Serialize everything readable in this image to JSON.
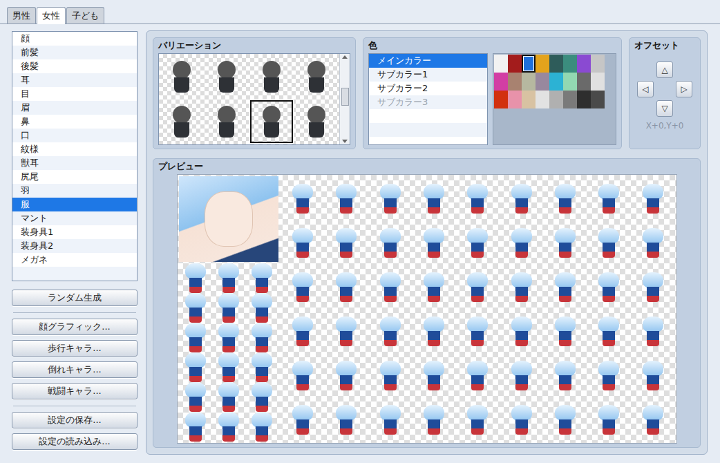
{
  "tabs": [
    {
      "label": "男性",
      "selected": false
    },
    {
      "label": "女性",
      "selected": true
    },
    {
      "label": "子ども",
      "selected": false
    }
  ],
  "parts": {
    "items": [
      {
        "label": "顔",
        "selected": false
      },
      {
        "label": "前髪",
        "selected": false
      },
      {
        "label": "後髪",
        "selected": false
      },
      {
        "label": "耳",
        "selected": false
      },
      {
        "label": "目",
        "selected": false
      },
      {
        "label": "眉",
        "selected": false
      },
      {
        "label": "鼻",
        "selected": false
      },
      {
        "label": "口",
        "selected": false
      },
      {
        "label": "紋様",
        "selected": false
      },
      {
        "label": "獣耳",
        "selected": false
      },
      {
        "label": "尻尾",
        "selected": false
      },
      {
        "label": "羽",
        "selected": false
      },
      {
        "label": "服",
        "selected": true
      },
      {
        "label": "マント",
        "selected": false
      },
      {
        "label": "装身具1",
        "selected": false
      },
      {
        "label": "装身具2",
        "selected": false
      },
      {
        "label": "メガネ",
        "selected": false
      }
    ]
  },
  "button_groups": [
    [
      "ランダム生成"
    ],
    [
      "顔グラフィック...",
      "歩行キャラ...",
      "倒れキャラ...",
      "戦闘キャラ..."
    ],
    [
      "設定の保存...",
      "設定の読み込み..."
    ]
  ],
  "variation": {
    "title": "バリエーション",
    "items": [
      {
        "selected": false
      },
      {
        "selected": false
      },
      {
        "selected": false
      },
      {
        "selected": false
      },
      {
        "selected": false
      },
      {
        "selected": false
      },
      {
        "selected": true
      },
      {
        "selected": false
      }
    ]
  },
  "color": {
    "title": "色",
    "targets": [
      {
        "label": "メインカラー",
        "selected": true,
        "disabled": false
      },
      {
        "label": "サブカラー1",
        "selected": false,
        "disabled": false
      },
      {
        "label": "サブカラー2",
        "selected": false,
        "disabled": false
      },
      {
        "label": "サブカラー3",
        "selected": false,
        "disabled": true
      }
    ],
    "palette": [
      {
        "color": "#f2f2f2",
        "selected": false
      },
      {
        "color": "#a31c1c",
        "selected": false
      },
      {
        "color": "#1e6fdc",
        "selected": true
      },
      {
        "color": "#e3a31c",
        "selected": false
      },
      {
        "color": "#2e5c5a",
        "selected": false
      },
      {
        "color": "#3b8d7e",
        "selected": false
      },
      {
        "color": "#8a4ad2",
        "selected": false
      },
      {
        "color": "#c6c6c6",
        "selected": false
      },
      {
        "color": "#d23ea4",
        "selected": false
      },
      {
        "color": "#a88270",
        "selected": false
      },
      {
        "color": "#b6b8a0",
        "selected": false
      },
      {
        "color": "#98889e",
        "selected": false
      },
      {
        "color": "#2cb2d4",
        "selected": false
      },
      {
        "color": "#92d8b2",
        "selected": false
      },
      {
        "color": "#6a6a6a",
        "selected": false
      },
      {
        "color": "#e0e0e0",
        "selected": false
      },
      {
        "color": "#d2300e",
        "selected": false
      },
      {
        "color": "#e892aa",
        "selected": false
      },
      {
        "color": "#d8c2a2",
        "selected": false
      },
      {
        "color": "#e2e2e2",
        "selected": false
      },
      {
        "color": "#b0b0b0",
        "selected": false
      },
      {
        "color": "#7a7a7a",
        "selected": false
      },
      {
        "color": "#2e2e2e",
        "selected": false
      },
      {
        "color": "#4a4a4a",
        "selected": false
      }
    ]
  },
  "offset": {
    "title": "オフセット",
    "up": "△",
    "left": "◁",
    "right": "▷",
    "down": "▽",
    "reading": "X+0,Y+0"
  },
  "preview": {
    "title": "プレビュー"
  }
}
